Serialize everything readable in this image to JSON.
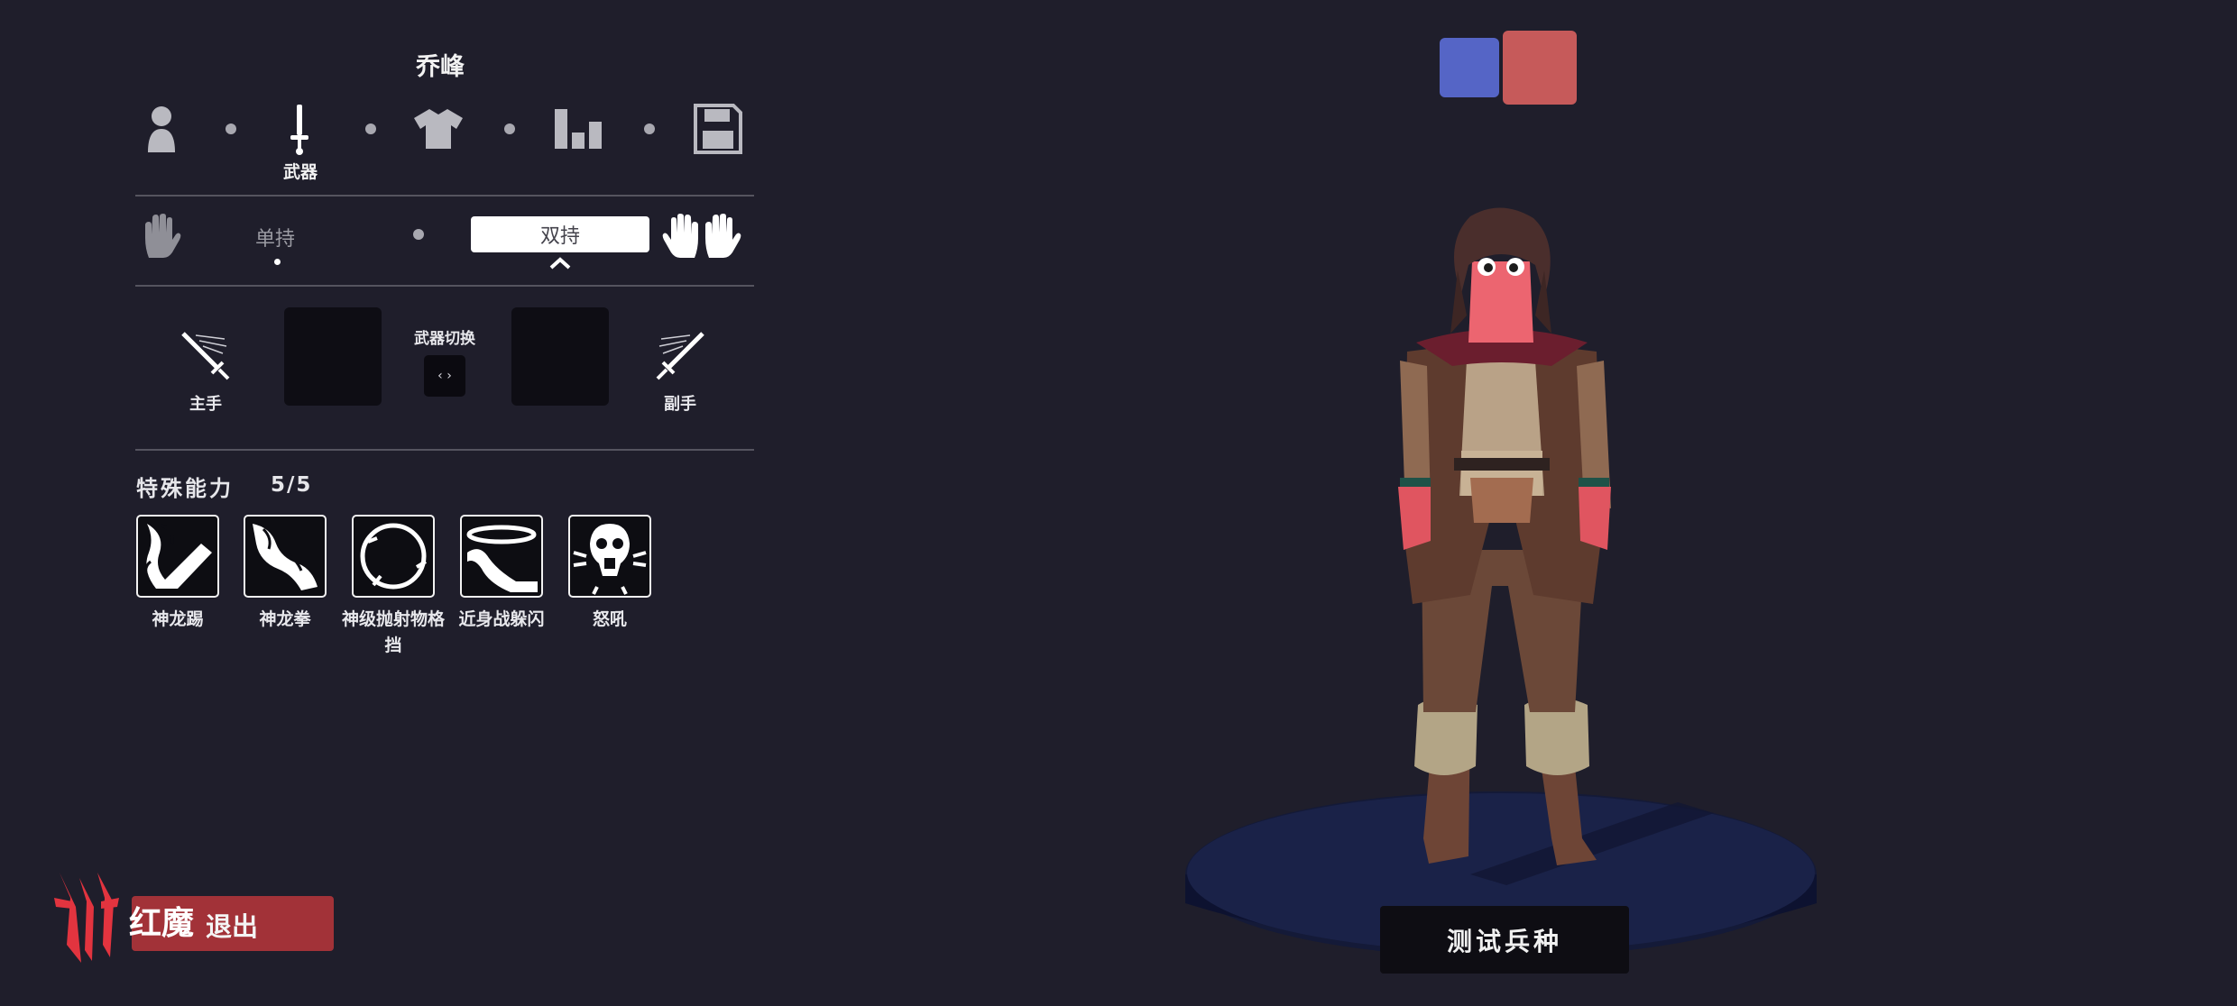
{
  "unit": {
    "name": "乔峰"
  },
  "nav": {
    "steps": [
      {
        "icon": "unit-person-icon"
      },
      {
        "icon": "sword-icon",
        "label": "武器"
      },
      {
        "icon": "shirt-icon"
      },
      {
        "icon": "stats-bars-icon"
      },
      {
        "icon": "save-floppy-icon"
      }
    ]
  },
  "grip": {
    "one_handed_label": "单持",
    "two_handed_label": "双持"
  },
  "weapons": {
    "main_hand_label": "主手",
    "off_hand_label": "副手",
    "switch_label": "武器切换",
    "switch_button": "‹ ›"
  },
  "abilities": {
    "title": "特殊能力",
    "count": "5/5",
    "items": [
      {
        "label": "神龙踢",
        "icon": "dragon-kick-icon"
      },
      {
        "label": "神龙拳",
        "icon": "dragon-punch-icon"
      },
      {
        "label": "神级抛射物格挡",
        "icon": "projectile-block-icon"
      },
      {
        "label": "近身战躲闪",
        "icon": "melee-dodge-icon"
      },
      {
        "label": "怒吼",
        "icon": "roar-icon"
      }
    ]
  },
  "team_colors": {
    "blue": "#5565c6",
    "red": "#c65a5a"
  },
  "test_button": {
    "label": "测试兵种"
  },
  "footer": {
    "brand": "红魔",
    "exit_label": "退出"
  }
}
